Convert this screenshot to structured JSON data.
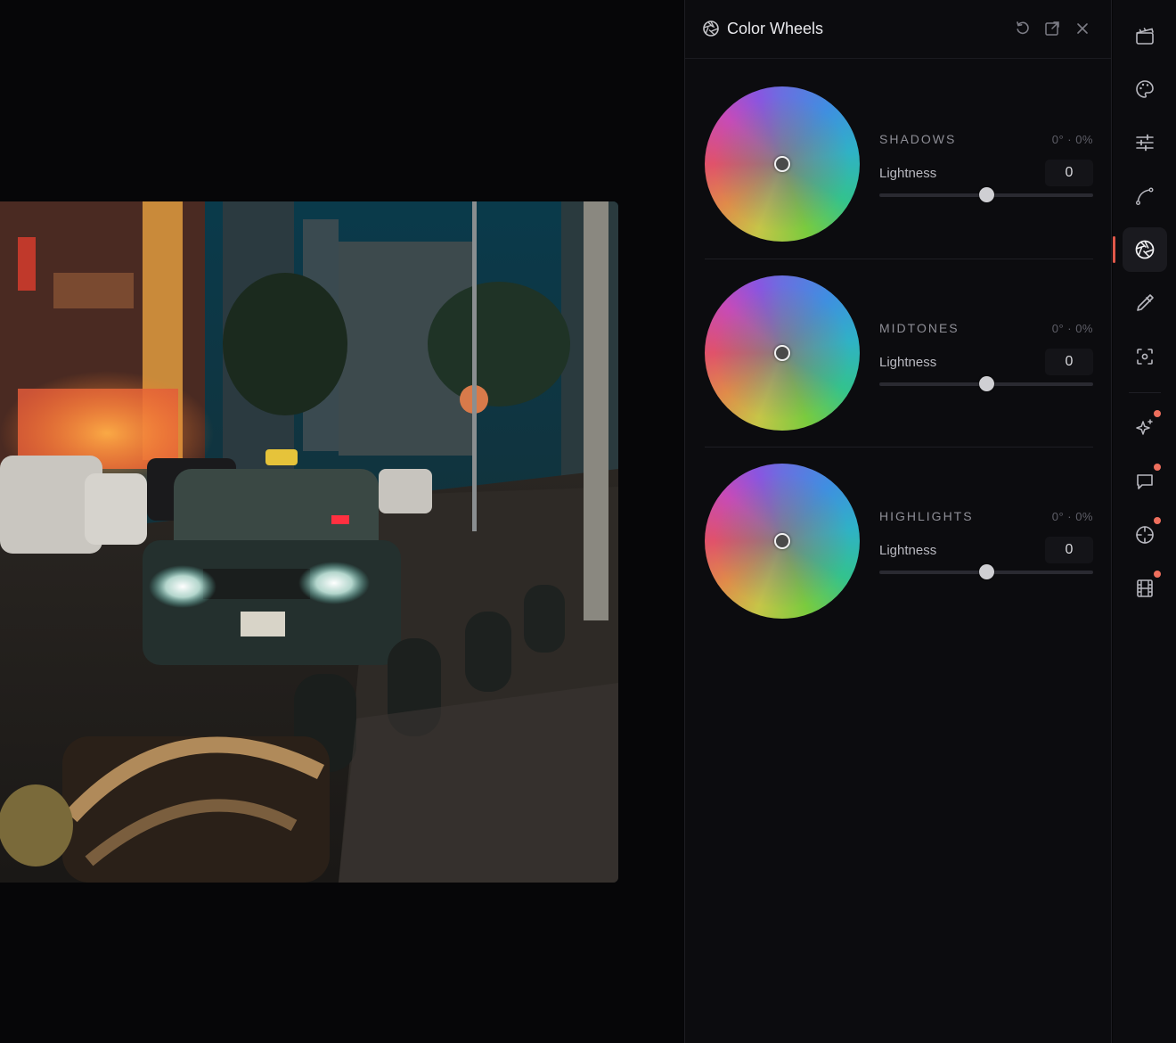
{
  "panel": {
    "title": "Color Wheels",
    "title_icon": "aperture-icon",
    "header_actions": [
      {
        "name": "reset-icon"
      },
      {
        "name": "pop-out-icon"
      },
      {
        "name": "close-icon"
      }
    ]
  },
  "wheels": [
    {
      "name": "SHADOWS",
      "readout": "0° · 0%",
      "lightness_label": "Lightness",
      "lightness_value": "0",
      "lightness_fraction": 0.5
    },
    {
      "name": "MIDTONES",
      "readout": "0° · 0%",
      "lightness_label": "Lightness",
      "lightness_value": "0",
      "lightness_fraction": 0.5
    },
    {
      "name": "HIGHLIGHTS",
      "readout": "0° · 0%",
      "lightness_label": "Lightness",
      "lightness_value": "0",
      "lightness_fraction": 0.5
    }
  ],
  "toolbar": {
    "tools": [
      {
        "icon": "clapperboard-icon",
        "active": false,
        "badge": false
      },
      {
        "icon": "palette-icon",
        "active": false,
        "badge": false
      },
      {
        "icon": "sliders-icon",
        "active": false,
        "badge": false
      },
      {
        "icon": "curve-icon",
        "active": false,
        "badge": false
      },
      {
        "icon": "aperture-icon",
        "active": true,
        "badge": false
      },
      {
        "icon": "eyedropper-icon",
        "active": false,
        "badge": false
      },
      {
        "icon": "focus-icon",
        "active": false,
        "badge": false
      },
      {
        "icon": "sparkles-icon",
        "active": false,
        "badge": true
      },
      {
        "icon": "comment-icon",
        "active": false,
        "badge": true
      },
      {
        "icon": "crosshair-icon",
        "active": false,
        "badge": true
      },
      {
        "icon": "film-icon",
        "active": false,
        "badge": true
      }
    ],
    "accent": "#e0584a"
  },
  "canvas": {
    "image": "night-street-photo"
  }
}
